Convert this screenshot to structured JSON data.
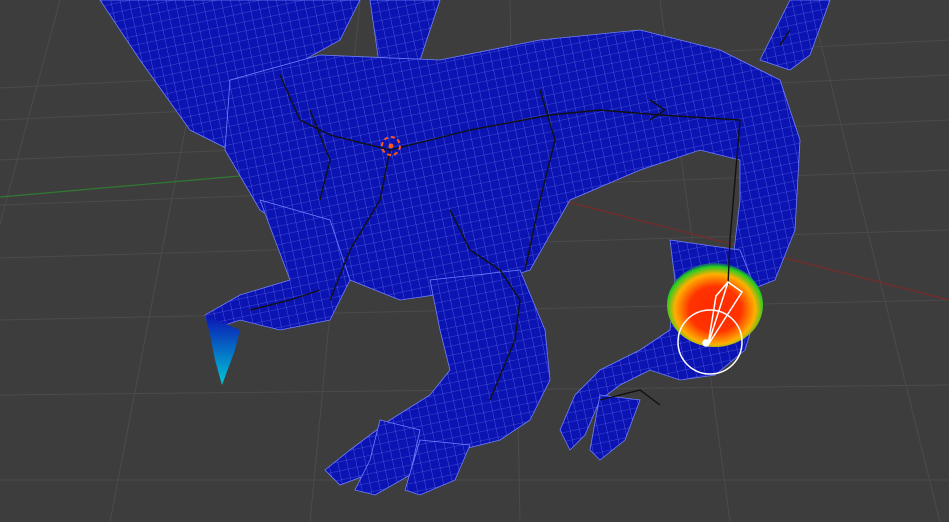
{
  "viewport": {
    "mode": "weight-paint",
    "background_color": "#3d3d3d",
    "grid_color": "#4a4a4a",
    "axis_x_color": "#8a2a2a",
    "axis_y_color": "#2f7a2f"
  },
  "mesh": {
    "name": "dragon-model",
    "base_color": "#0a12b0",
    "wire_color": "#8fa0ff",
    "weight_colors": [
      "#ff2200",
      "#ffaa00",
      "#22cc22",
      "#00bcd4"
    ]
  },
  "armature": {
    "line_color": "#111111",
    "active_bone_color": "#ffffff"
  },
  "cursor_3d": {
    "color": "#ff5a1a"
  }
}
